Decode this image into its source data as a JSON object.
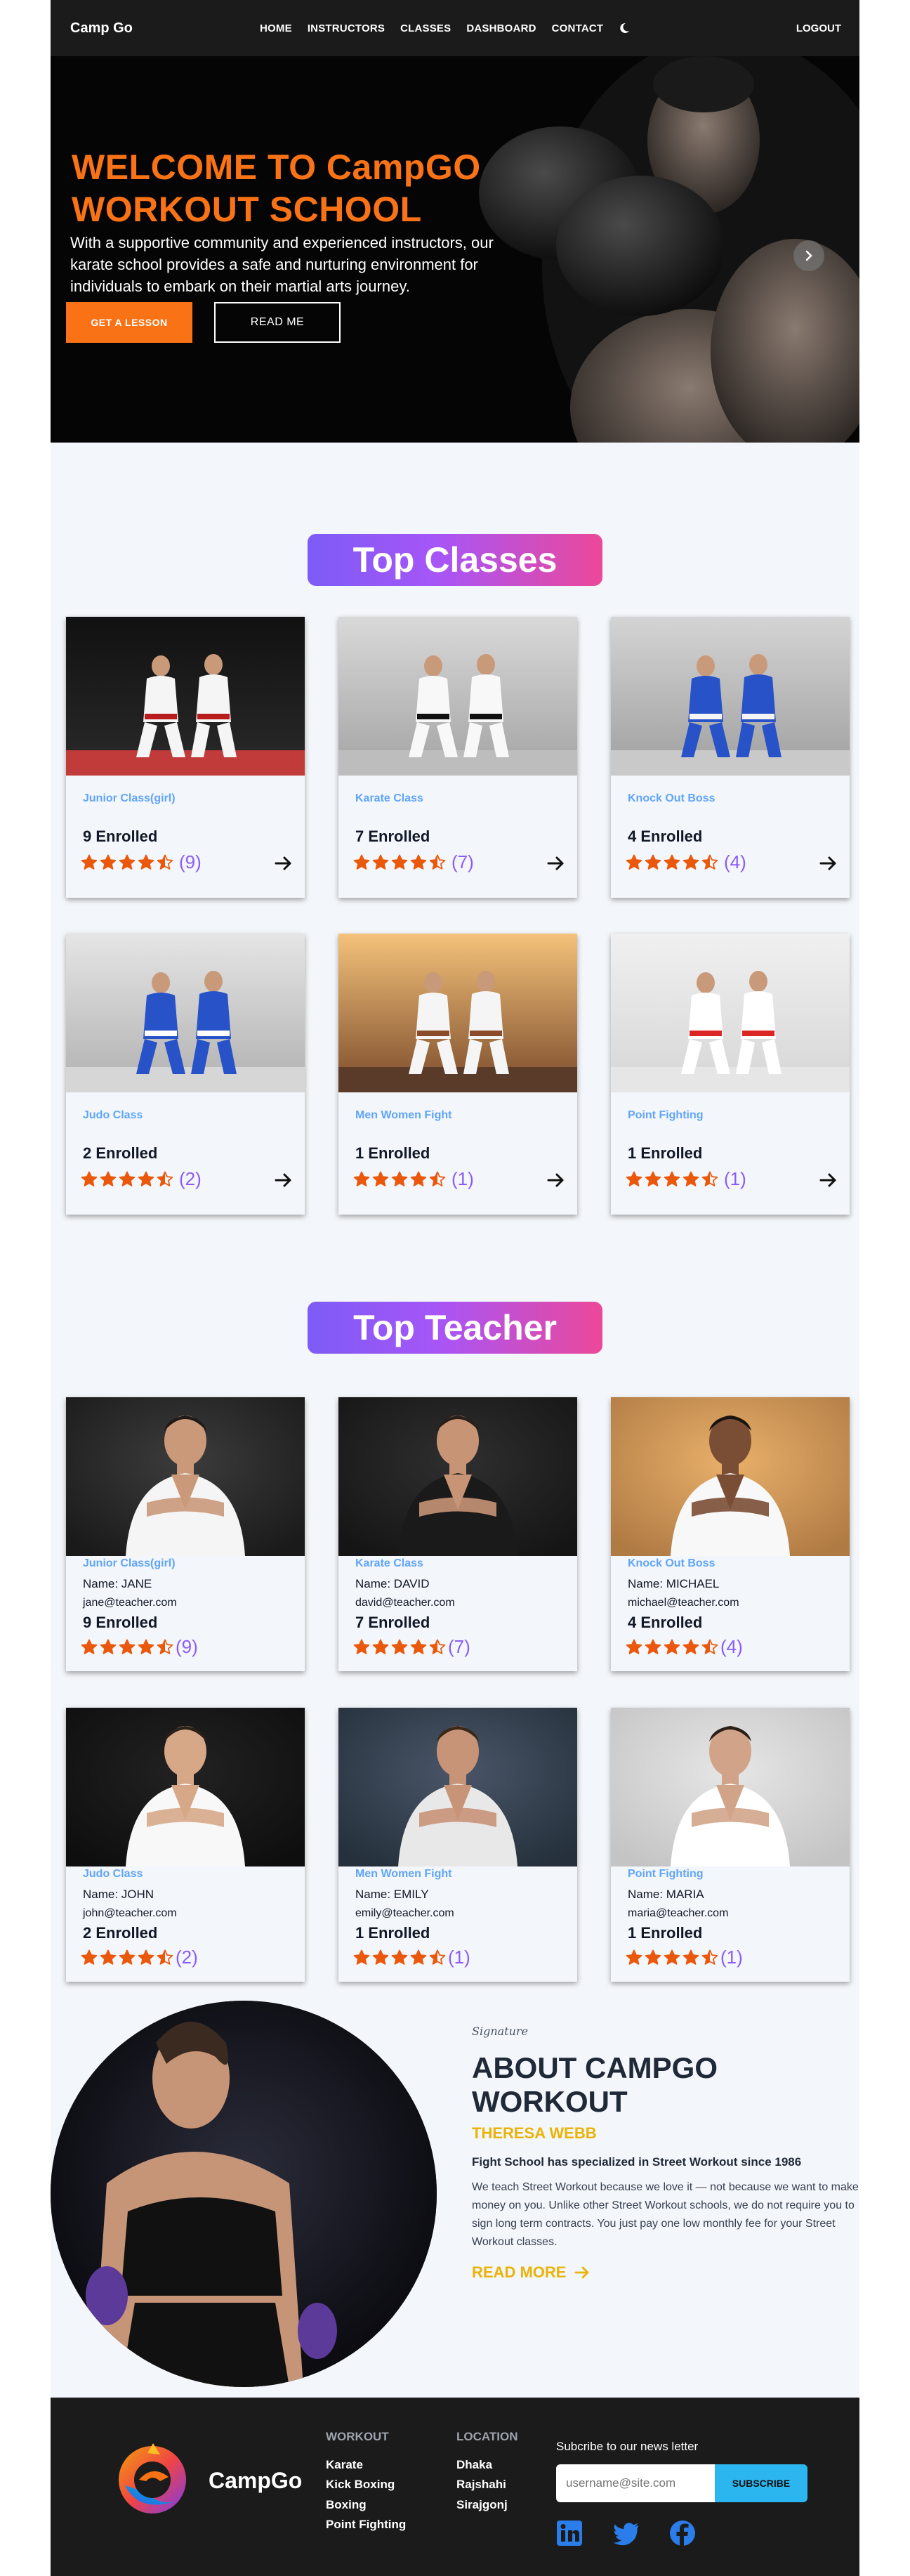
{
  "nav": {
    "brand": "Camp Go",
    "items": [
      "HOME",
      "INSTRUCTORS",
      "CLASSES",
      "DASHBOARD",
      "CONTACT"
    ],
    "logout": "LOGOUT"
  },
  "hero": {
    "title": "WELCOME TO CampGO WORKOUT SCHOOL",
    "text": "With a supportive community and experienced instructors, our karate school provides a safe and nurturing environment for individuals to embark on their martial arts journey.",
    "primary_button": "GET A LESSON",
    "secondary_button": "READ ME"
  },
  "classes": {
    "title": "Top Classes",
    "items": [
      {
        "name": "Junior Class(girl)",
        "enrolled": "9 Enrolled",
        "rating": 4.5,
        "count": "(9)"
      },
      {
        "name": "Karate Class",
        "enrolled": "7 Enrolled",
        "rating": 4.5,
        "count": "(7)"
      },
      {
        "name": "Knock Out Boss",
        "enrolled": "4 Enrolled",
        "rating": 4.5,
        "count": "(4)"
      },
      {
        "name": "Judo Class",
        "enrolled": "2 Enrolled",
        "rating": 4.5,
        "count": "(2)"
      },
      {
        "name": "Men Women Fight",
        "enrolled": "1 Enrolled",
        "rating": 4.5,
        "count": "(1)"
      },
      {
        "name": "Point Fighting",
        "enrolled": "1 Enrolled",
        "rating": 4.5,
        "count": "(1)"
      }
    ]
  },
  "teachers": {
    "title": "Top Teacher",
    "items": [
      {
        "course": "Junior Class(girl)",
        "name": "Name: JANE",
        "email": "jane@teacher.com",
        "enrolled": "9 Enrolled",
        "count": "(9)"
      },
      {
        "course": "Karate Class",
        "name": "Name: DAVID",
        "email": "david@teacher.com",
        "enrolled": "7 Enrolled",
        "count": "(7)"
      },
      {
        "course": "Knock Out Boss",
        "name": "Name: MICHAEL",
        "email": "michael@teacher.com",
        "enrolled": "4 Enrolled",
        "count": "(4)"
      },
      {
        "course": "Judo Class",
        "name": "Name: JOHN",
        "email": "john@teacher.com",
        "enrolled": "2 Enrolled",
        "count": "(2)"
      },
      {
        "course": "Men Women Fight",
        "name": "Name: EMILY",
        "email": "emily@teacher.com",
        "enrolled": "1 Enrolled",
        "count": "(1)"
      },
      {
        "course": "Point Fighting",
        "name": "Name: MARIA",
        "email": "maria@teacher.com",
        "enrolled": "1 Enrolled",
        "count": "(1)"
      }
    ]
  },
  "about": {
    "signature": "Signature",
    "title": "ABOUT CAMPGO WORKOUT",
    "name": "THERESA WEBB",
    "tagline": "Fight School has specialized in Street Workout since 1986",
    "text": "We teach Street Workout because we love it — not because we want to make money on you. Unlike other Street Workout schools, we do not require you to sign long term contracts. You just pay one low monthly fee for your Street Workout classes.",
    "read_more": "READ MORE"
  },
  "footer": {
    "brand": "CampGo",
    "workout_heading": "WORKOUT",
    "workout_links": [
      "Karate",
      "Kick Boxing",
      "Boxing",
      "Point Fighting"
    ],
    "location_heading": "LOCATION",
    "location_links": [
      "Dhaka",
      "Rajshahi",
      "Sirajgonj"
    ],
    "newsletter_label": "Subcribe to our news letter",
    "newsletter_placeholder": "username@site.com",
    "subscribe_button": "SUBSCRIBE"
  },
  "colors": {
    "accent": "#f97316",
    "link_blue": "#60a5fa",
    "rating_purple": "#8b5cf6",
    "gold": "#eab308",
    "subscribe": "#2cb6f0",
    "nav_bg": "#1b1b1b"
  },
  "icons": [
    "moon-icon",
    "chevron-right-icon",
    "star-icon",
    "arrow-right-icon",
    "linkedin-icon",
    "twitter-icon",
    "facebook-icon"
  ]
}
